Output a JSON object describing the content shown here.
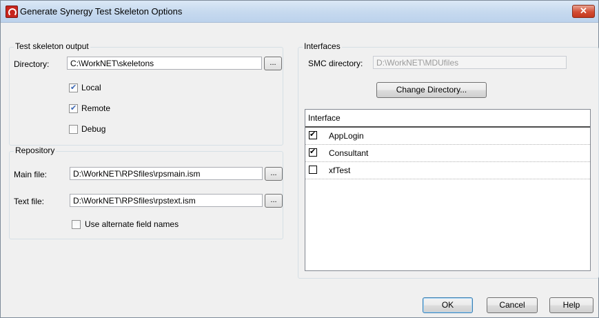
{
  "window": {
    "title": "Generate Synergy Test Skeleton Options",
    "close_glyph": "✕"
  },
  "output_group": {
    "title": "Test skeleton output",
    "directory_label": "Directory:",
    "directory_value": "C:\\WorkNET\\skeletons",
    "browse_label": "...",
    "local": {
      "label": "Local",
      "checked": true
    },
    "remote": {
      "label": "Remote",
      "checked": true
    },
    "debug": {
      "label": "Debug",
      "checked": false
    }
  },
  "repository_group": {
    "title": "Repository",
    "main_file_label": "Main file:",
    "main_file_value": "D:\\WorkNET\\RPSfiles\\rpsmain.ism",
    "text_file_label": "Text file:",
    "text_file_value": "D:\\WorkNET\\RPSfiles\\rpstext.ism",
    "browse_label": "...",
    "alternate": {
      "label": "Use alternate field names",
      "checked": false
    }
  },
  "interfaces_group": {
    "title": "Interfaces",
    "smc_label": "SMC directory:",
    "smc_value": "D:\\WorkNET\\MDUfiles",
    "change_directory_label": "Change Directory...",
    "list_header": "Interface",
    "items": [
      {
        "label": "AppLogin",
        "checked": true
      },
      {
        "label": "Consultant",
        "checked": true
      },
      {
        "label": "xfTest",
        "checked": false
      }
    ]
  },
  "buttons": {
    "ok": "OK",
    "cancel": "Cancel",
    "help": "Help"
  },
  "colors": {
    "dialog_bg": "#f0f0f0",
    "titlebar": "#c7daef",
    "close_button": "#d24c33",
    "group_border": "#d5dfe5"
  },
  "icons": [
    "app-logo-icon",
    "close-icon",
    "checkmark-icon"
  ]
}
